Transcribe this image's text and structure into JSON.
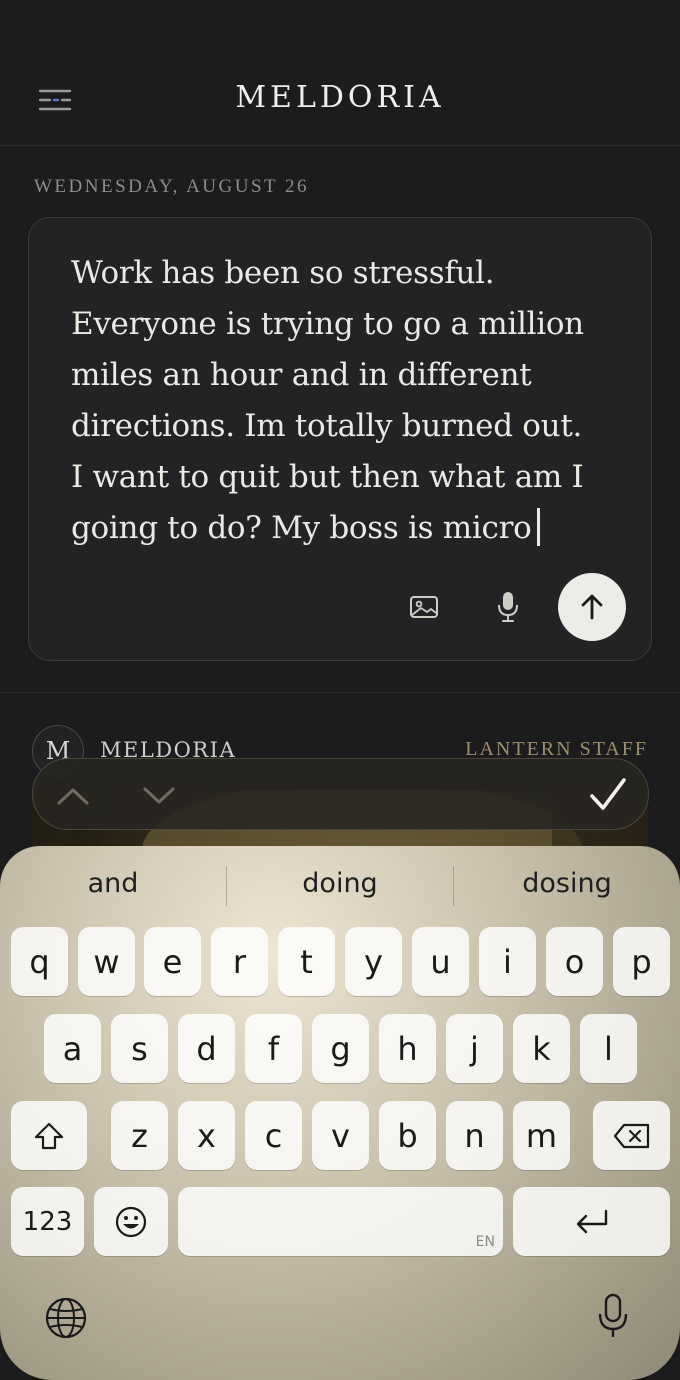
{
  "header": {
    "title": "MELDORIA",
    "menu_icon": "menu-icon"
  },
  "entry": {
    "date": "WEDNESDAY, AUGUST 26",
    "lines": [
      "Work has been so stressful.",
      "Everyone is trying to go a million",
      "miles an hour and in different",
      "directions. Im totally burned out.",
      "I want to quit but then what am I",
      "going to do? My boss is micro"
    ],
    "icons": {
      "image": "image-icon",
      "mic": "microphone-icon",
      "send": "arrow-up-icon"
    }
  },
  "feed": {
    "avatar_letter": "M",
    "author": "MELDORIA",
    "tag": "LANTERN STAFF"
  },
  "input_nav": {
    "prev": "chevron-up-icon",
    "next": "chevron-down-icon",
    "done": "checkmark-icon"
  },
  "keyboard": {
    "suggestions": [
      "and",
      "doing",
      "dosing"
    ],
    "row1": [
      "q",
      "w",
      "e",
      "r",
      "t",
      "y",
      "u",
      "i",
      "o",
      "p"
    ],
    "row2": [
      "a",
      "s",
      "d",
      "f",
      "g",
      "h",
      "j",
      "k",
      "l"
    ],
    "row3": [
      "z",
      "x",
      "c",
      "v",
      "b",
      "n",
      "m"
    ],
    "numbers_key": "123",
    "space_hint": "EN",
    "icons": {
      "shift": "shift-icon",
      "delete": "delete-icon",
      "emoji": "emoji-icon",
      "return": "return-icon",
      "globe": "globe-icon",
      "dictation": "microphone-icon"
    }
  }
}
